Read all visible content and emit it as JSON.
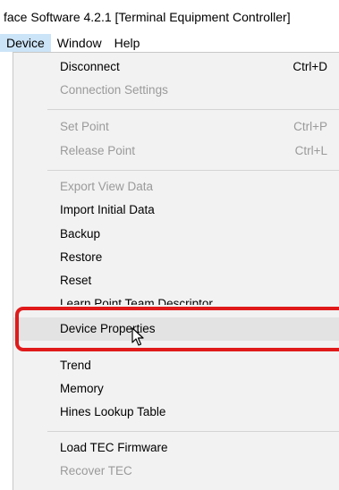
{
  "window": {
    "title": "face Software 4.2.1 [Terminal Equipment Controller]"
  },
  "menubar": {
    "items": [
      {
        "label": "Device"
      },
      {
        "label": "Window"
      },
      {
        "label": "Help"
      }
    ]
  },
  "device_menu": {
    "items": [
      {
        "label": "Disconnect",
        "shortcut": "Ctrl+D",
        "enabled": true
      },
      {
        "label": "Connection Settings",
        "shortcut": "",
        "enabled": false
      },
      {
        "label": "Set Point",
        "shortcut": "Ctrl+P",
        "enabled": false
      },
      {
        "label": "Release Point",
        "shortcut": "Ctrl+L",
        "enabled": false
      },
      {
        "label": "Export View Data",
        "shortcut": "",
        "enabled": false
      },
      {
        "label": "Import Initial Data",
        "shortcut": "",
        "enabled": true
      },
      {
        "label": "Backup",
        "shortcut": "",
        "enabled": true
      },
      {
        "label": "Restore",
        "shortcut": "",
        "enabled": true
      },
      {
        "label": "Reset",
        "shortcut": "",
        "enabled": true
      },
      {
        "label": "Learn Point Team Descriptor",
        "shortcut": "",
        "enabled": true
      },
      {
        "label": "Device Properties",
        "shortcut": "",
        "enabled": true,
        "hovered": true
      },
      {
        "label": "Trend",
        "shortcut": "",
        "enabled": true
      },
      {
        "label": "Memory",
        "shortcut": "",
        "enabled": true
      },
      {
        "label": "Hines Lookup Table",
        "shortcut": "",
        "enabled": true
      },
      {
        "label": "Load TEC Firmware",
        "shortcut": "",
        "enabled": true
      },
      {
        "label": "Recover TEC",
        "shortcut": "",
        "enabled": false
      }
    ]
  },
  "colors": {
    "highlight_border": "#e01a1a",
    "menu_background": "#f2f2f2",
    "disabled_text": "#9a9a9a",
    "hover_background": "#e3e3e3"
  },
  "icons": {
    "cursor": "arrow-pointer-icon"
  }
}
